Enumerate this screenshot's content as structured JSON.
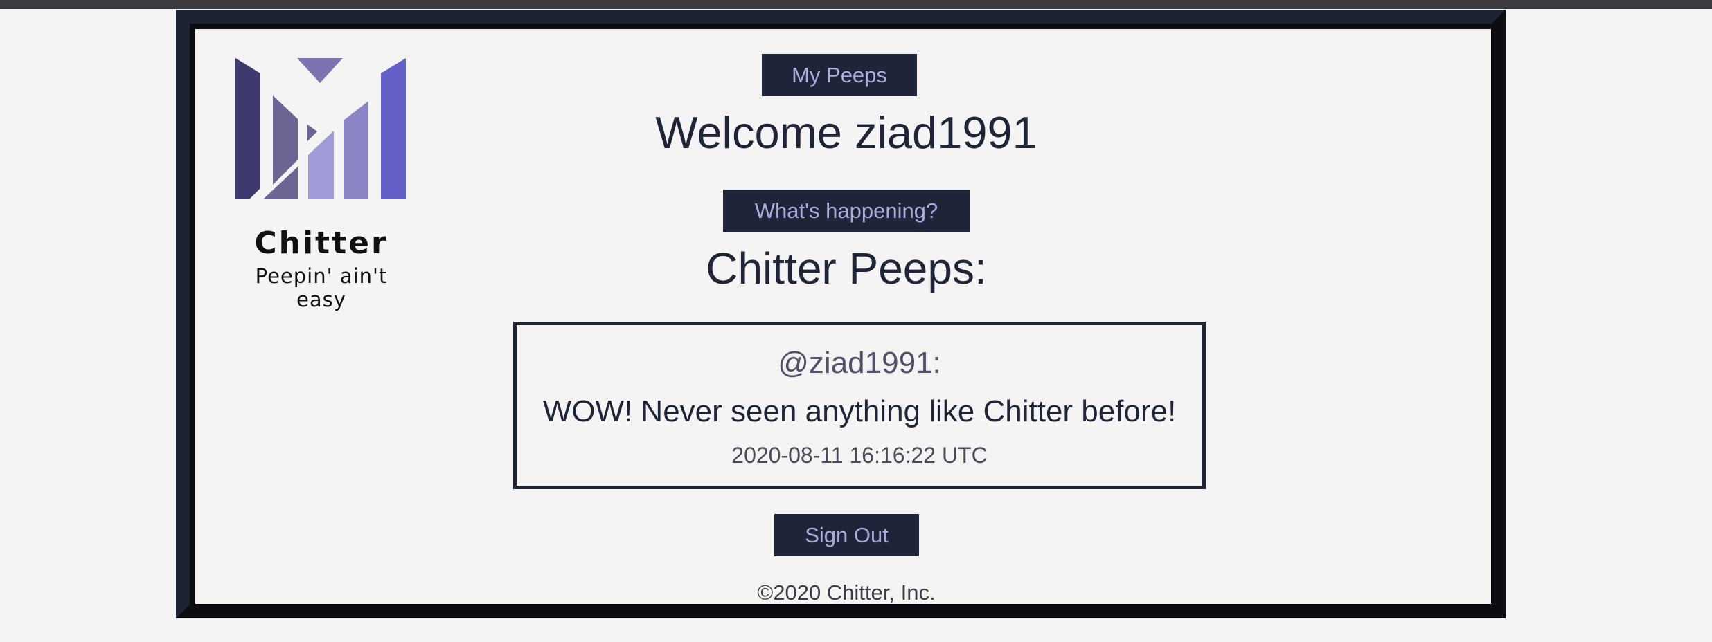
{
  "logo": {
    "brand": "Chitter",
    "tagline": "Peepin' ain't easy",
    "colors": [
      "#3e3a6e",
      "#6a6592",
      "#8a86c6",
      "#9e9bd8",
      "#645fc9"
    ]
  },
  "nav": {
    "my_peeps_label": "My Peeps",
    "whats_happening_label": "What's happening?",
    "sign_out_label": "Sign Out"
  },
  "welcome": {
    "title": "Welcome ziad1991"
  },
  "peeps": {
    "heading": "Chitter Peeps:",
    "items": [
      {
        "user": "@ziad1991:",
        "text": "WOW! Never seen anything like Chitter before!",
        "timestamp": "2020-08-11 16:16:22 UTC"
      }
    ]
  },
  "footer": {
    "copyright": "©2020 Chitter, Inc."
  },
  "colors": {
    "accent": "#1f2439",
    "button_text": "#a8addb",
    "background": "#f4f4f4"
  }
}
